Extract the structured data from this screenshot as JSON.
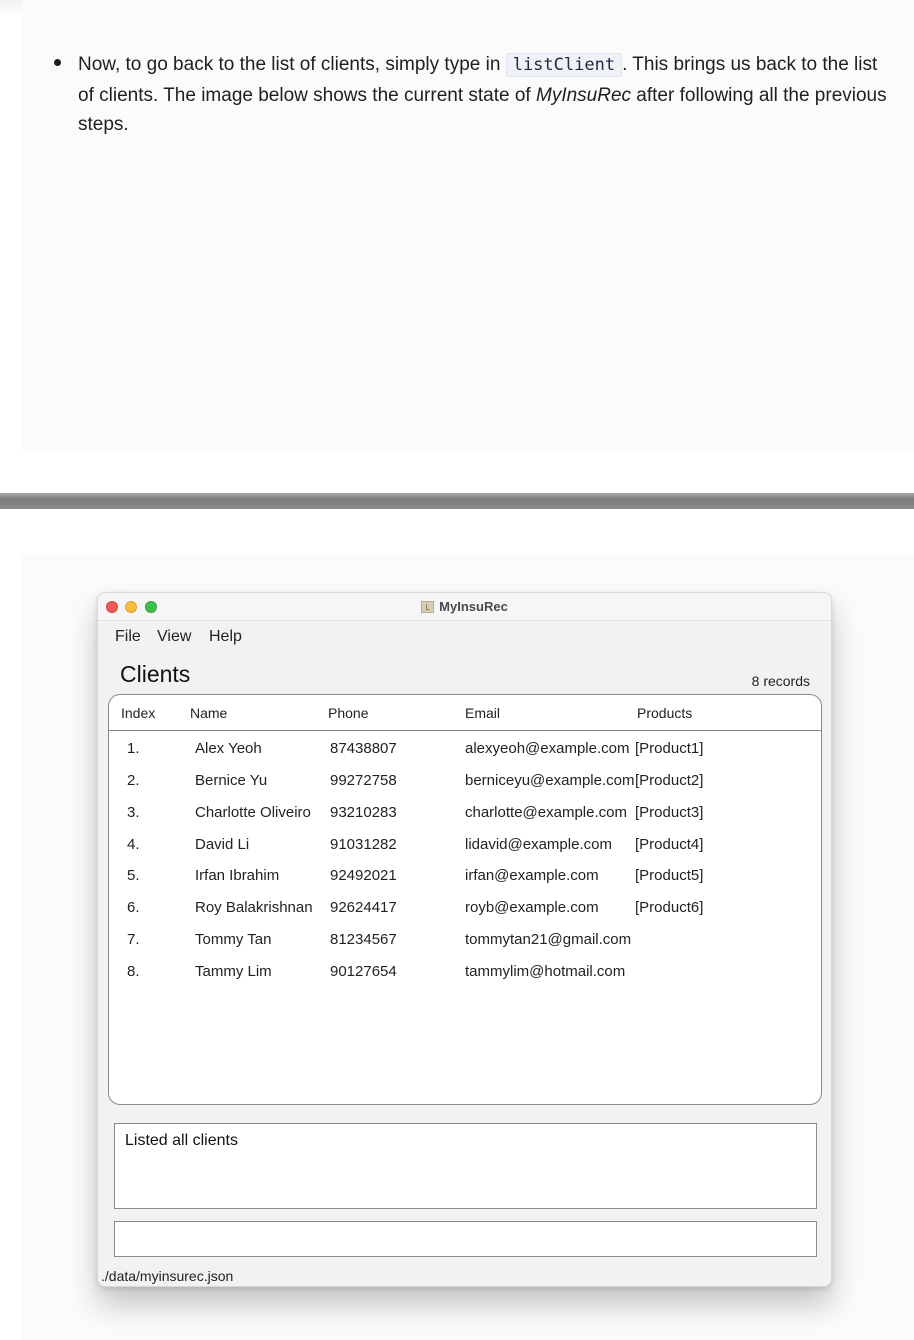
{
  "doc": {
    "bullet": {
      "part1": "Now, to go back to the list of clients, simply type in ",
      "code": "listClient",
      "part2": ". This brings us back to the list of clients. The image below shows the current state of ",
      "app_name": "MyInsuRec",
      "part3": " after following all the previous steps."
    }
  },
  "window": {
    "title": "MyInsuRec",
    "menu": [
      "File",
      "View",
      "Help"
    ],
    "section_title": "Clients",
    "record_count": "8 records",
    "table": {
      "headers": [
        "Index",
        "Name",
        "Phone",
        "Email",
        "Products"
      ],
      "rows": [
        {
          "index": "1.",
          "name": "Alex Yeoh",
          "phone": "87438807",
          "email": "alexyeoh@example.com",
          "products": "[Product1]"
        },
        {
          "index": "2.",
          "name": "Bernice Yu",
          "phone": "99272758",
          "email": "berniceyu@example.com",
          "products": "[Product2]"
        },
        {
          "index": "3.",
          "name": "Charlotte Oliveiro",
          "phone": "93210283",
          "email": "charlotte@example.com",
          "products": "[Product3]"
        },
        {
          "index": "4.",
          "name": "David Li",
          "phone": "91031282",
          "email": "lidavid@example.com",
          "products": "[Product4]"
        },
        {
          "index": "5.",
          "name": "Irfan Ibrahim",
          "phone": "92492021",
          "email": "irfan@example.com",
          "products": "[Product5]"
        },
        {
          "index": "6.",
          "name": "Roy Balakrishnan",
          "phone": "92624417",
          "email": "royb@example.com",
          "products": "[Product6]"
        },
        {
          "index": "7.",
          "name": "Tommy Tan",
          "phone": "81234567",
          "email": "tommytan21@gmail.com",
          "products": ""
        },
        {
          "index": "8.",
          "name": "Tammy Lim",
          "phone": "90127654",
          "email": "tammylim@hotmail.com",
          "products": ""
        }
      ]
    },
    "result_text": "Listed all clients",
    "command_value": "",
    "status_path": "./data/myinsurec.json"
  }
}
